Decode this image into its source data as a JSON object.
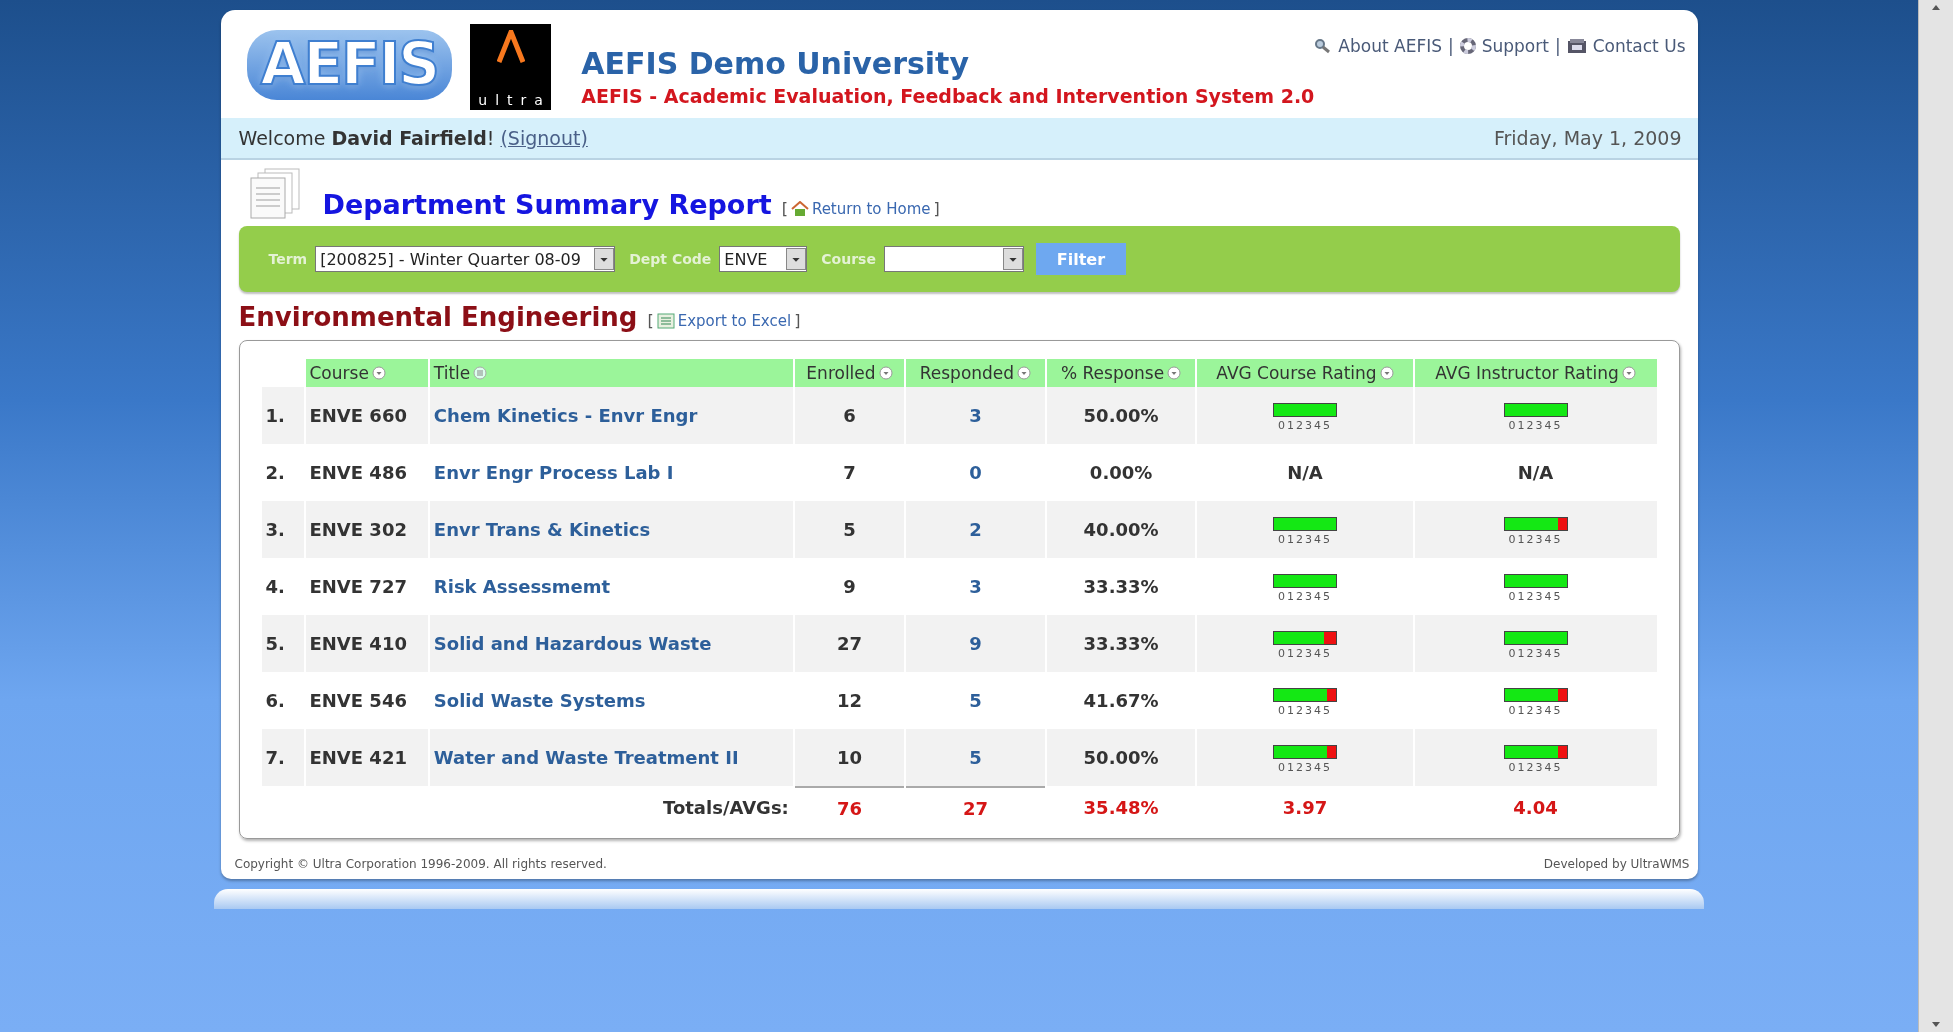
{
  "header": {
    "logo": "AEFIS",
    "partner_logo": "ultra",
    "title": "AEFIS Demo University",
    "subtitle": "AEFIS - Academic Evaluation, Feedback and Intervention System 2.0",
    "links": [
      {
        "label": "About AEFIS"
      },
      {
        "label": "Support"
      },
      {
        "label": "Contact Us"
      }
    ],
    "separator": "|"
  },
  "welcome": {
    "text": "Welcome **David Fairfield**!",
    "signout": "(Signout)",
    "date": "Friday, May 1, 2009"
  },
  "report": {
    "title": "Department Summary Report",
    "brackets": [
      "[",
      "]"
    ],
    "home_link": "Return to Home"
  },
  "filter": {
    "fields": [
      {
        "label": "Term",
        "value": "[200825] - Winter Quarter 08-09",
        "kind": "wide"
      },
      {
        "label": "Dept Code",
        "value": "ENVE",
        "kind": "narrow"
      },
      {
        "label": "Course",
        "kind": "medium"
      }
    ],
    "button": "Filter"
  },
  "department": {
    "name": "Environmental Engineering",
    "brackets": [
      "[",
      "]"
    ],
    "export_link": "Export to Excel"
  },
  "table": {
    "columns": [
      {
        "label": "Course",
        "sorted": false
      },
      {
        "label": "Title",
        "sorted": true
      },
      {
        "label": "Enrolled",
        "sorted": false
      },
      {
        "label": "Responded",
        "sorted": false
      },
      {
        "label": "% Response",
        "sorted": false
      },
      {
        "label": "AVG Course Rating",
        "sorted": false
      },
      {
        "label": "AVG Instructor Rating",
        "sorted": false
      }
    ],
    "rows": [
      {
        "index": "1.",
        "course": "ENVE 660",
        "title": "Chem Kinetics - Envr Engr",
        "enrolled": "6",
        "responded": "3",
        "response": "50.00%",
        "course_rating": {
          "kind": "bar",
          "level": 1,
          "scale": "012345"
        },
        "instructor_rating": {
          "kind": "bar",
          "level": 1,
          "scale": "012345"
        }
      },
      {
        "index": "2.",
        "course": "ENVE 486",
        "title": "Envr Engr Process Lab I",
        "enrolled": "7",
        "responded": "0",
        "response": "0.00%",
        "course_rating": {
          "kind": "na",
          "text": "N/A"
        },
        "instructor_rating": {
          "kind": "na",
          "text": "N/A"
        }
      },
      {
        "index": "3.",
        "course": "ENVE 302",
        "title": "Envr Trans & Kinetics",
        "enrolled": "5",
        "responded": "2",
        "response": "40.00%",
        "course_rating": {
          "kind": "bar",
          "level": 1,
          "scale": "012345"
        },
        "instructor_rating": {
          "kind": "bar",
          "level": 0.87,
          "scale": "012345"
        }
      },
      {
        "index": "4.",
        "course": "ENVE 727",
        "title": "Risk Assessmemt",
        "enrolled": "9",
        "responded": "3",
        "response": "33.33%",
        "course_rating": {
          "kind": "bar",
          "level": 1,
          "scale": "012345"
        },
        "instructor_rating": {
          "kind": "bar",
          "level": 1,
          "scale": "012345"
        }
      },
      {
        "index": "5.",
        "course": "ENVE 410",
        "title": "Solid and Hazardous Waste",
        "enrolled": "27",
        "responded": "9",
        "response": "33.33%",
        "course_rating": {
          "kind": "bar",
          "level": 0.8,
          "scale": "012345"
        },
        "instructor_rating": {
          "kind": "bar",
          "level": 1,
          "scale": "012345"
        }
      },
      {
        "index": "6.",
        "course": "ENVE 546",
        "title": "Solid Waste Systems",
        "enrolled": "12",
        "responded": "5",
        "response": "41.67%",
        "course_rating": {
          "kind": "bar",
          "level": 0.85,
          "scale": "012345"
        },
        "instructor_rating": {
          "kind": "bar",
          "level": 0.87,
          "scale": "012345"
        }
      },
      {
        "index": "7.",
        "course": "ENVE 421",
        "title": "Water and Waste Treatment II",
        "enrolled": "10",
        "responded": "5",
        "response": "50.00%",
        "course_rating": {
          "kind": "bar",
          "level": 0.85,
          "scale": "012345"
        },
        "instructor_rating": {
          "kind": "bar",
          "level": 0.87,
          "scale": "012345"
        }
      }
    ],
    "totals": {
      "label": "Totals/AVGs:",
      "enrolled": "76",
      "responded": "27",
      "response": "35.48%",
      "course_rating": "3.97",
      "instructor_rating": "4.04"
    }
  },
  "footer": {
    "copyright": "Copyright © Ultra Corporation 1996-2009. All rights reserved.",
    "developer": "Developed by UltraWMS"
  }
}
